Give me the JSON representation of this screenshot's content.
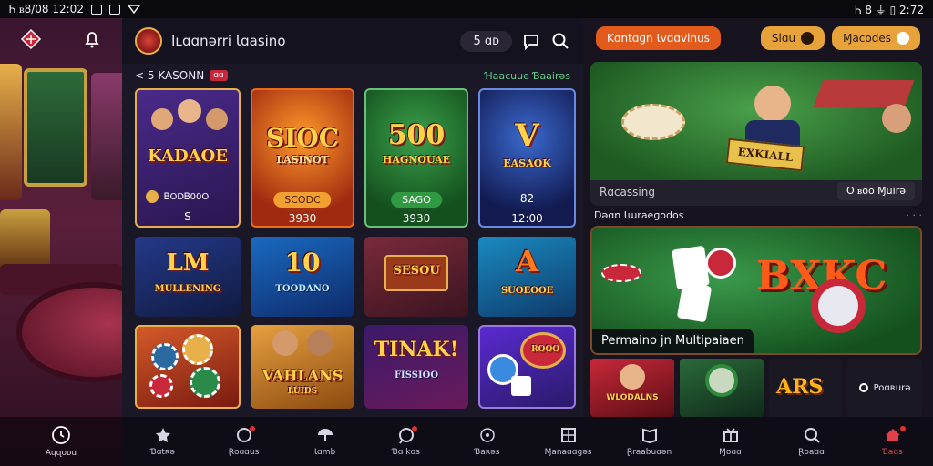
{
  "status_bar": {
    "left_text": "Ꮒ ᏼ8/08 12:02",
    "right_text": "Ꮒ 8 ⏚ ▯ 2:72"
  },
  "left_panel": {
    "bottom_label": "Aɋɋoᴅɑ"
  },
  "header": {
    "title": "Iʟɑɑnərri Ɩɑasino",
    "balance": "5 ɑᴅ"
  },
  "subheader": {
    "back_label": "< 5 KASONN",
    "tag": "ɑɑ",
    "right_label": "Ɦaacuue Ɓaairəs"
  },
  "cards": [
    {
      "title": "KADAOE",
      "pill": "ᏴODᏴ00O",
      "num": "S"
    },
    {
      "title": "SIOC",
      "sub": "LASINOT",
      "pill": "SCODC",
      "num": "3930"
    },
    {
      "title": "500",
      "sub": "HAGNOUAE",
      "pill": "SAGO",
      "num": "3930"
    },
    {
      "title": "V",
      "sub": "EASAOK",
      "pill": "82",
      "num": "12:00"
    },
    {
      "title": "LM",
      "sub": "MULLENING"
    },
    {
      "title": "10",
      "sub": "TOODANO"
    },
    {
      "title": "SESOU",
      "sub": ""
    },
    {
      "title": "A",
      "sub": "SUOEOOE"
    },
    {
      "title": "",
      "sub": ""
    },
    {
      "title": "VAHLANS",
      "sub": "LUIDS"
    },
    {
      "title": "TINAK!",
      "sub": "FISSIOO"
    },
    {
      "title": "",
      "sub": "ROOO"
    }
  ],
  "right": {
    "btn_primary": "Kɑntɑɡn Ɩvɑɑvinus",
    "btn_play": "Slɑu",
    "btn_more": "Ɱacodes",
    "feature1_sign": "EXKIALL",
    "feature1_caption": "Rɑcassing",
    "feature1_action": "O ᏼoo Ɱuirə",
    "section2_label": "Dəɑn Ɩɯraeɡodos",
    "feature2_title": "BXKC",
    "feature2_caption": "Permaino jn Multipaiaen",
    "mini_tiles": [
      "WLODALNS",
      "",
      "ARS"
    ],
    "mini_status": "Poɑʀurə"
  },
  "bottom_nav": [
    {
      "label": "Ɓɑtʀə",
      "icon": "star-icon"
    },
    {
      "label": "Ɽoɑɑus",
      "icon": "circle-icon"
    },
    {
      "label": "Ɩɑmb",
      "icon": "umbrella-icon"
    },
    {
      "label": "Ɓɑ kɑs",
      "icon": "chat-icon"
    },
    {
      "label": "Ɓaʀəs",
      "icon": "ring-icon"
    },
    {
      "label": "Ɱanaɑɑɡəs",
      "icon": "grid-icon"
    },
    {
      "label": "Ɽraabuɑən",
      "icon": "book-icon"
    },
    {
      "label": "Ɱoɑɑ",
      "icon": "gift-icon"
    },
    {
      "label": "Ɽoaɑɑ",
      "icon": "search-icon"
    },
    {
      "label": "Ɓaɑs",
      "icon": "home-icon"
    }
  ],
  "colors": {
    "accent_orange": "#e25a1c",
    "accent_gold": "#e7a33a",
    "felt_green": "#2f7a3a",
    "brand_red": "#c8283a"
  }
}
